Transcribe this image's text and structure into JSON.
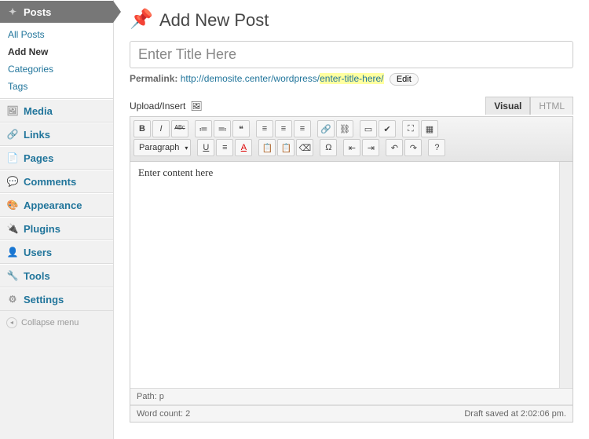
{
  "sidebar": {
    "posts": {
      "label": "Posts",
      "items": [
        "All Posts",
        "Add New",
        "Categories",
        "Tags"
      ],
      "active_index": 1
    },
    "media": "Media",
    "links": "Links",
    "pages": "Pages",
    "comments": "Comments",
    "appearance": "Appearance",
    "plugins": "Plugins",
    "users": "Users",
    "tools": "Tools",
    "settings": "Settings",
    "collapse": "Collapse menu"
  },
  "page": {
    "heading": "Add New Post",
    "title_value": "Enter Title Here",
    "permalink_label": "Permalink:",
    "permalink_base": "http://demosite.center/wordpress/",
    "permalink_slug": "enter-title-here/",
    "edit_label": "Edit"
  },
  "editor": {
    "upload_label": "Upload/Insert",
    "tabs": {
      "visual": "Visual",
      "html": "HTML"
    },
    "paragraph_label": "Paragraph",
    "content": "Enter content here",
    "path_label": "Path:",
    "path_value": "p",
    "word_count_label": "Word count:",
    "word_count": "2",
    "draft_saved": "Draft saved at 2:02:06 pm."
  }
}
